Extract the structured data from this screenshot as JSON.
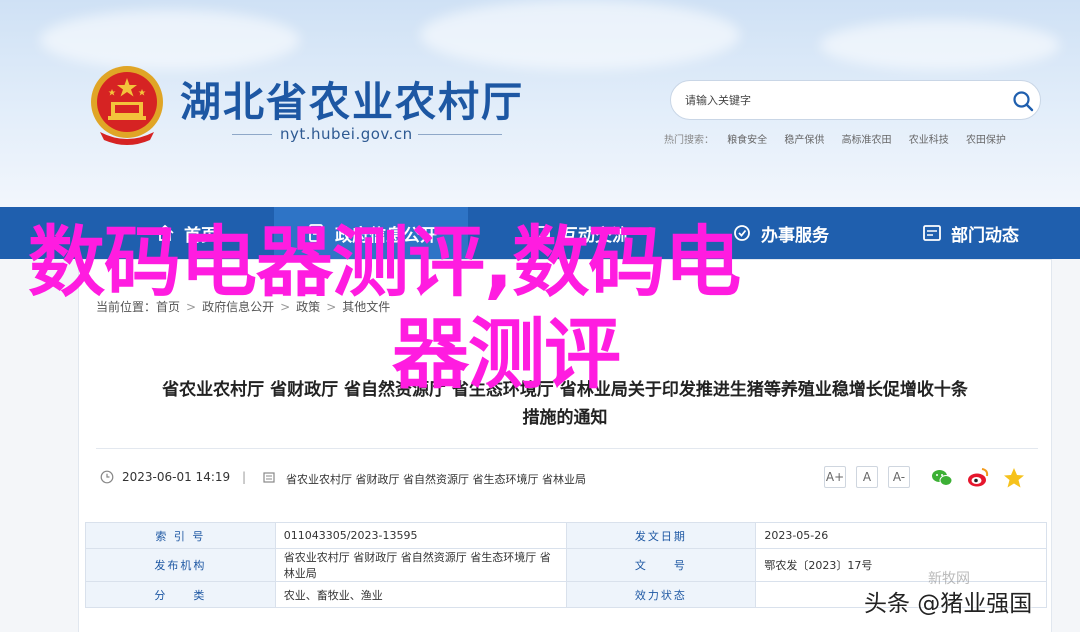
{
  "header": {
    "site_title": "湖北省农业农村厅",
    "site_url": "nyt.hubei.gov.cn",
    "search_placeholder": "请输入关键字",
    "hot_search_label": "热门搜索：",
    "hot_searches": [
      "粮食安全",
      "稳产保供",
      "高标准农田",
      "农业科技",
      "农田保护"
    ]
  },
  "nav": {
    "items": [
      {
        "label": "首页",
        "icon": "home-icon"
      },
      {
        "label": "政府信息公开",
        "icon": "document-icon",
        "active": true
      },
      {
        "label": "互动交流",
        "icon": "chat-icon"
      },
      {
        "label": "办事服务",
        "icon": "service-icon"
      },
      {
        "label": "部门动态",
        "icon": "news-icon"
      }
    ]
  },
  "breadcrumb": {
    "items": [
      "当前位置：",
      "首页",
      "政府信息公开",
      "政策",
      "其他文件"
    ]
  },
  "article": {
    "title_line1": "省农业农村厅 省财政厅 省自然资源厅 省生态环境厅 省林业局关于印发推进生猪等养殖业稳增长促增收十条",
    "title_line2": "措施的通知",
    "date": "2023-06-01 14:19",
    "separator": "|",
    "sources": "省农业农村厅 省财政厅 省自然资源厅 省生态环境厅 省林业局",
    "font_buttons": [
      "A+",
      "A",
      "A-"
    ]
  },
  "info_table": {
    "rows": [
      [
        {
          "k": "索 引 号",
          "v": "011043305/2023-13595"
        },
        {
          "k": "发文日期",
          "v": "2023-05-26"
        }
      ],
      [
        {
          "k": "发布机构",
          "v": "省农业农村厅 省财政厅 省自然资源厅 省生态环境厅 省林业局"
        },
        {
          "k": "文　　号",
          "v": "鄂农发〔2023〕17号"
        }
      ],
      [
        {
          "k": "分　　类",
          "v": "农业、畜牧业、渔业"
        },
        {
          "k": "效力状态",
          "v": ""
        }
      ]
    ]
  },
  "watermarks": {
    "overlay_line1": "数码电器测评,数码电",
    "overlay_line2": "器测评",
    "faint": "新牧网",
    "toutiao": "头条 @猪业强国"
  },
  "colors": {
    "brand_blue": "#1f5fae",
    "title_blue": "#1d57a3",
    "overlay_magenta": "#ff1ce0"
  }
}
